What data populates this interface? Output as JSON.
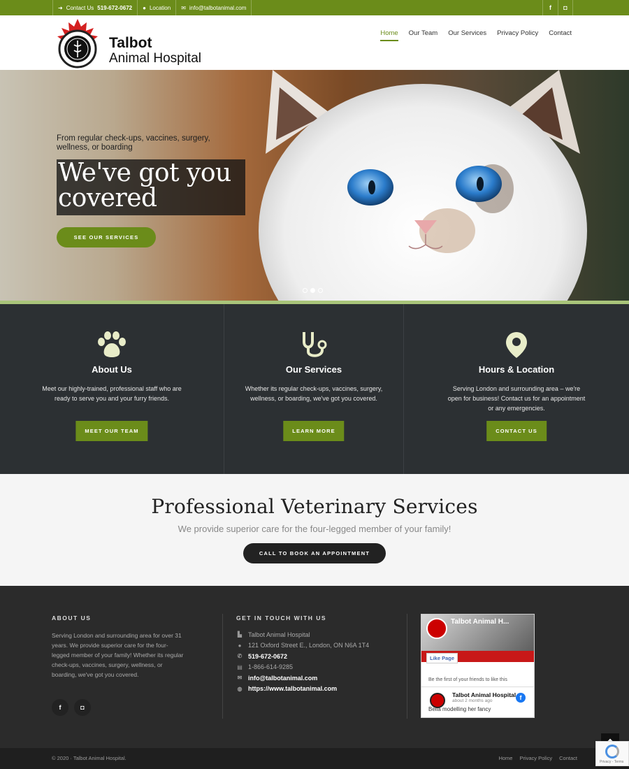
{
  "topbar": {
    "contact_label": "Contact Us",
    "phone": "519-672-0672",
    "location_label": "Location",
    "email": "info@talbotanimal.com",
    "social": [
      "f",
      "ig"
    ]
  },
  "brand": {
    "name_line1": "Talbot",
    "name_line2": "Animal Hospital"
  },
  "nav": {
    "items": [
      {
        "label": "Home",
        "active": true
      },
      {
        "label": "Our Team"
      },
      {
        "label": "Our Services"
      },
      {
        "label": "Privacy Policy"
      },
      {
        "label": "Contact"
      }
    ]
  },
  "hero": {
    "subtitle": "From regular check-ups, vaccines, surgery, wellness, or boarding",
    "title": "We've got you covered",
    "button": "SEE OUR SERVICES",
    "slides": 3,
    "active_slide": 2
  },
  "features": [
    {
      "icon": "paw-icon",
      "title": "About Us",
      "text": "Meet our highly-trained, professional staff who are ready to serve you and your furry friends.",
      "button": "MEET OUR TEAM"
    },
    {
      "icon": "stethoscope-icon",
      "title": "Our Services",
      "text": "Whether its regular check-ups, vaccines, surgery, wellness, or boarding, we've got you covered.",
      "button": "LEARN MORE"
    },
    {
      "icon": "map-pin-icon",
      "title": "Hours & Location",
      "text": "Serving London and surrounding area – we're open for business! Contact us for an appointment or any emergencies.",
      "button": "CONTACT US"
    }
  ],
  "services": {
    "heading": "Professional Veterinary Services",
    "subheading": "We provide superior care for the four-legged member of your family!",
    "button": "CALL TO BOOK AN APPOINTMENT"
  },
  "footer": {
    "about_title": "ABOUT US",
    "about_text": "Serving London and surrounding area for over 31 years. We provide superior care for the four-legged member of your family! Whether its regular check-ups, vaccines, surgery, wellness, or boarding, we've got you covered.",
    "contact_title": "GET IN TOUCH WITH US",
    "contact": {
      "name": "Talbot Animal Hospital",
      "address": "121 Oxford Street E., London, ON N6A 1T4",
      "phone": "519-672-0672",
      "fax": "1-866-614-9285",
      "email": "info@talbotanimal.com",
      "website": "https://www.talbotanimal.com"
    },
    "facebook": {
      "page_name": "Talbot Animal H...",
      "like_label": "Like Page",
      "friends_text": "Be the first of your friends to like this",
      "post_name": "Talbot Animal Hospital",
      "post_time": "about 2 months ago",
      "post_text": "Bella modelling her fancy"
    },
    "copyright": "© 2020 · Talbot Animal Hospital.",
    "links": [
      "Home",
      "Privacy Policy",
      "Contact"
    ]
  },
  "recaptcha": {
    "text": "Privacy - Terms"
  },
  "colors": {
    "brand_green": "#6b8c1a",
    "dark_panel": "#2c3033",
    "footer_bg": "#2b2b2b"
  }
}
